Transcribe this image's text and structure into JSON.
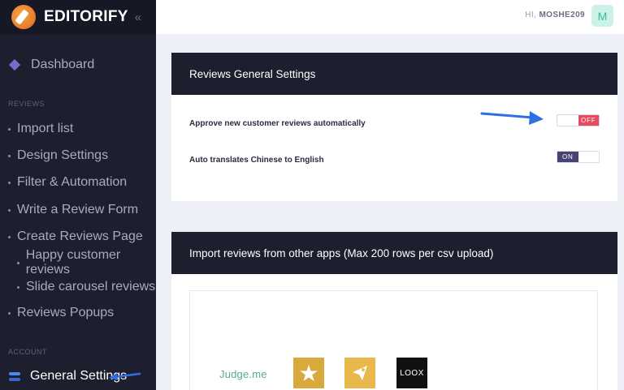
{
  "brand": {
    "name": "EDITORIFY",
    "collapse_glyph": "«"
  },
  "topbar": {
    "greeting": "HI,",
    "username": "MOSHE209",
    "avatar_letter": "M"
  },
  "sidebar": {
    "dashboard": "Dashboard",
    "section_reviews": "REVIEWS",
    "items": [
      {
        "label": "Import list"
      },
      {
        "label": "Design Settings"
      },
      {
        "label": "Filter & Automation"
      },
      {
        "label": "Write a Review Form"
      },
      {
        "label": "Create Reviews Page"
      },
      {
        "label": "Happy customer reviews"
      },
      {
        "label": "Slide carousel reviews"
      },
      {
        "label": "Reviews Popups"
      }
    ],
    "section_account": "ACCOUNT",
    "general_settings": "General Settings"
  },
  "general": {
    "title": "Reviews General Settings",
    "settings": [
      {
        "label": "Approve new customer reviews automatically",
        "state": "OFF"
      },
      {
        "label": "Auto translates Chinese to English",
        "state": "ON"
      }
    ],
    "on_text": "ON",
    "off_text": "OFF"
  },
  "import": {
    "title": "Import reviews from other apps (Max 200 rows per csv upload)",
    "apps": [
      "Judge.me",
      "star-icon",
      "bird-icon",
      "LOOX"
    ]
  },
  "colors": {
    "sidebar_bg": "#1e1f2e",
    "off_red": "#e8495c",
    "on_purple": "#474474",
    "arrow_blue": "#2f6fe6"
  }
}
